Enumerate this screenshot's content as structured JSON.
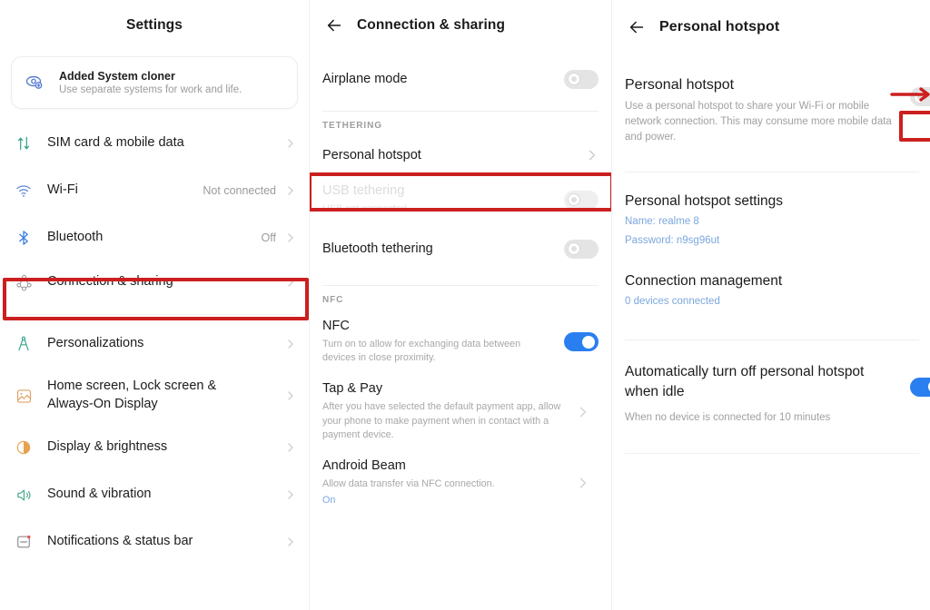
{
  "panels": {
    "settings": {
      "title": "Settings",
      "promo": {
        "icon": "system-cloner-icon",
        "title": "Added System cloner",
        "subtitle": "Use separate systems for work and life."
      },
      "items": [
        {
          "icon": "sim-card-icon",
          "label": "SIM card & mobile data",
          "value": "",
          "chevron": true
        },
        {
          "icon": "wifi-icon",
          "label": "Wi-Fi",
          "value": "Not connected",
          "chevron": true
        },
        {
          "icon": "bluetooth-icon",
          "label": "Bluetooth",
          "value": "Off",
          "chevron": true
        },
        {
          "icon": "connection-sharing-icon",
          "label": "Connection & sharing",
          "value": "",
          "chevron": true
        },
        {
          "icon": "personalizations-icon",
          "label": "Personalizations",
          "value": "",
          "chevron": true
        },
        {
          "icon": "home-screen-icon",
          "label": "Home screen, Lock screen &\nAlways-On Display",
          "value": "",
          "chevron": true
        },
        {
          "icon": "display-brightness-icon",
          "label": "Display & brightness",
          "value": "",
          "chevron": true
        },
        {
          "icon": "sound-vibration-icon",
          "label": "Sound & vibration",
          "value": "",
          "chevron": true
        },
        {
          "icon": "notifications-icon",
          "label": "Notifications & status bar",
          "value": "",
          "chevron": true
        }
      ]
    },
    "connection": {
      "title": "Connection & sharing",
      "back_icon": "back-arrow-icon",
      "airplane": {
        "label": "Airplane mode",
        "toggle": "off"
      },
      "tethering_label": "TETHERING",
      "tethering": [
        {
          "name": "personal-hotspot",
          "title": "Personal hotspot",
          "subtitle": "",
          "control": "chevron",
          "disabled": false
        },
        {
          "name": "usb-tethering",
          "title": "USB tethering",
          "subtitle": "USB not connected",
          "control": "toggle-off",
          "disabled": true
        },
        {
          "name": "bluetooth-tethering",
          "title": "Bluetooth tethering",
          "subtitle": "",
          "control": "toggle-off",
          "disabled": false
        }
      ],
      "nfc_label": "NFC",
      "nfc": [
        {
          "name": "nfc",
          "title": "NFC",
          "subtitle": "Turn on to allow for exchanging data between devices in close proximity.",
          "control": "toggle-on",
          "extra": ""
        },
        {
          "name": "tap-and-pay",
          "title": "Tap & Pay",
          "subtitle": "After you have selected the default payment app, allow your phone to make payment when in contact with a payment device.",
          "control": "chevron",
          "extra": ""
        },
        {
          "name": "android-beam",
          "title": "Android Beam",
          "subtitle": "Allow data transfer via NFC connection.",
          "control": "chevron",
          "extra": "On"
        }
      ]
    },
    "hotspot": {
      "title": "Personal hotspot",
      "back_icon": "back-arrow-icon",
      "main": {
        "title": "Personal hotspot",
        "subtitle": "Use a personal hotspot to share your Wi-Fi or mobile network connection. This may consume more mobile data and power.",
        "toggle": "off"
      },
      "settings": {
        "title": "Personal hotspot settings",
        "name_line": "Name: realme 8",
        "password_line": "Password: n9sg96ut"
      },
      "connection_management": {
        "title": "Connection management",
        "status": "0 devices connected"
      },
      "auto_off": {
        "title": "Automatically turn off personal hotspot when idle",
        "subtitle": "When no device is connected for 10 minutes",
        "toggle": "on"
      }
    }
  },
  "annotations": {
    "accent_color": "#cc1f1f",
    "boxes": [
      {
        "name": "highlight-connection-sharing"
      },
      {
        "name": "highlight-personal-hotspot-row"
      },
      {
        "name": "highlight-hotspot-toggle"
      }
    ],
    "arrow": {
      "name": "pointer-arrow-to-toggle"
    }
  },
  "colors": {
    "toggle_on": "#2a7ff0",
    "toggle_off": "#e4e4e4",
    "link_blue": "#7ba7dd",
    "annotation_red": "#cc1f1f"
  }
}
